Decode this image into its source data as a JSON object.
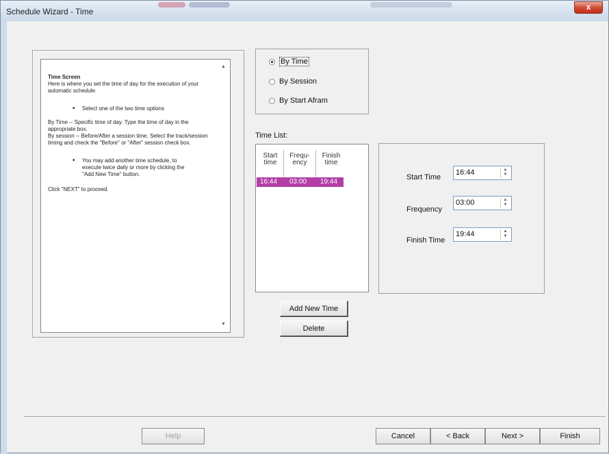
{
  "window": {
    "title": "Schedule Wizard - Time",
    "close_glyph": "x"
  },
  "help": {
    "heading": "Time Screen",
    "intro": "Here is where you set the time of day for the execution of your automatic schedule.",
    "bullet1": "Select one of the two time options",
    "by_time": "By Time -- Specific time of day. Type the time of day in the appropriate box.",
    "by_session": "By session -- Before/After a session time. Select the track/session timing and check the \"Before\" or \"After\" session check box.",
    "bullet2": "You may add another time schedule, to execute twice daily or more by clicking the \"Add New Time\" button.",
    "next_hint": "Click \"NEXT\" to proceed.",
    "scroll_up": "▲",
    "scroll_down": "▼"
  },
  "options": {
    "by_time": "By Time",
    "by_session": "By Session",
    "by_start": "By Start Afram",
    "selected": "by_time"
  },
  "time_list": {
    "label": "Time List:",
    "columns": [
      {
        "line1": "Start",
        "line2": "time"
      },
      {
        "line1": "Frequ-",
        "line2": "ency"
      },
      {
        "line1": "Finish",
        "line2": "time"
      }
    ],
    "rows": [
      [
        "16:44",
        "03:00",
        "19:44"
      ]
    ],
    "highlight_color": "#b23ea6"
  },
  "time_fields": {
    "start_label": "Start Time",
    "start_value": "16:44",
    "frequency_label": "Frequency",
    "frequency_value": "03:00",
    "finish_label": "Finish Time",
    "finish_value": "19:44",
    "spin_up": "▲",
    "spin_down": "▼"
  },
  "buttons": {
    "add_new_time": "Add New Time",
    "delete": "Delete",
    "help": "Help",
    "cancel": "Cancel",
    "back": "< Back",
    "next": "Next >",
    "finish": "Finish"
  }
}
